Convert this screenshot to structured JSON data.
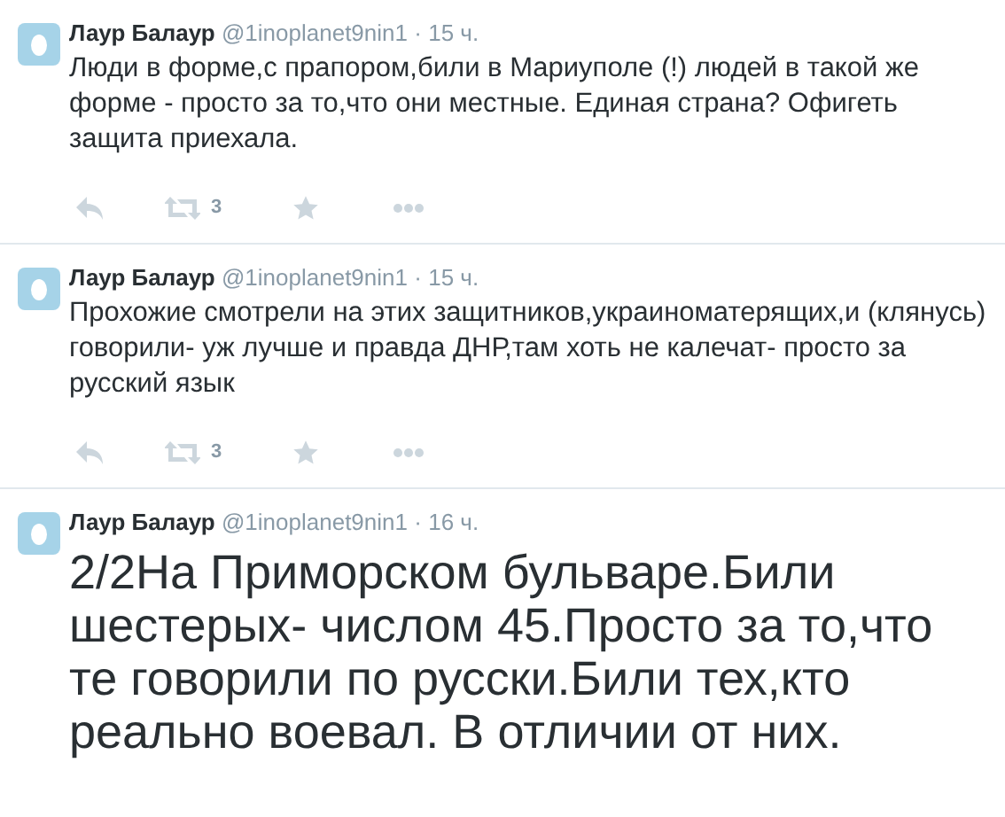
{
  "tweets": [
    {
      "kind": "normal",
      "author": "Лаур Балаур",
      "handle": "@1inoplanet9nin1",
      "separator": "·",
      "time": "15 ч.",
      "text": "Люди в форме,с прапором,били в Мариуполе (!) людей в такой же форме - просто за то,что они местные. Единая страна? Офигеть защита приехала.",
      "retweets": "3"
    },
    {
      "kind": "normal",
      "author": "Лаур Балаур",
      "handle": "@1inoplanet9nin1",
      "separator": "·",
      "time": "15 ч.",
      "text": "Прохожие смотрели на этих защитников,украиноматерящих,и (клянусь) говорили- уж лучше и правда ДНР,там хоть не калечат- просто за русский язык",
      "retweets": "3"
    },
    {
      "kind": "large",
      "author": "Лаур Балаур",
      "handle": "@1inoplanet9nin1",
      "separator": "·",
      "time": "16 ч.",
      "text": "2/2На Приморском бульваре.Били шестерых- числом 45.Просто за то,что те говорили по русски.Били тех,кто реально воевал. В отличии от них."
    }
  ]
}
